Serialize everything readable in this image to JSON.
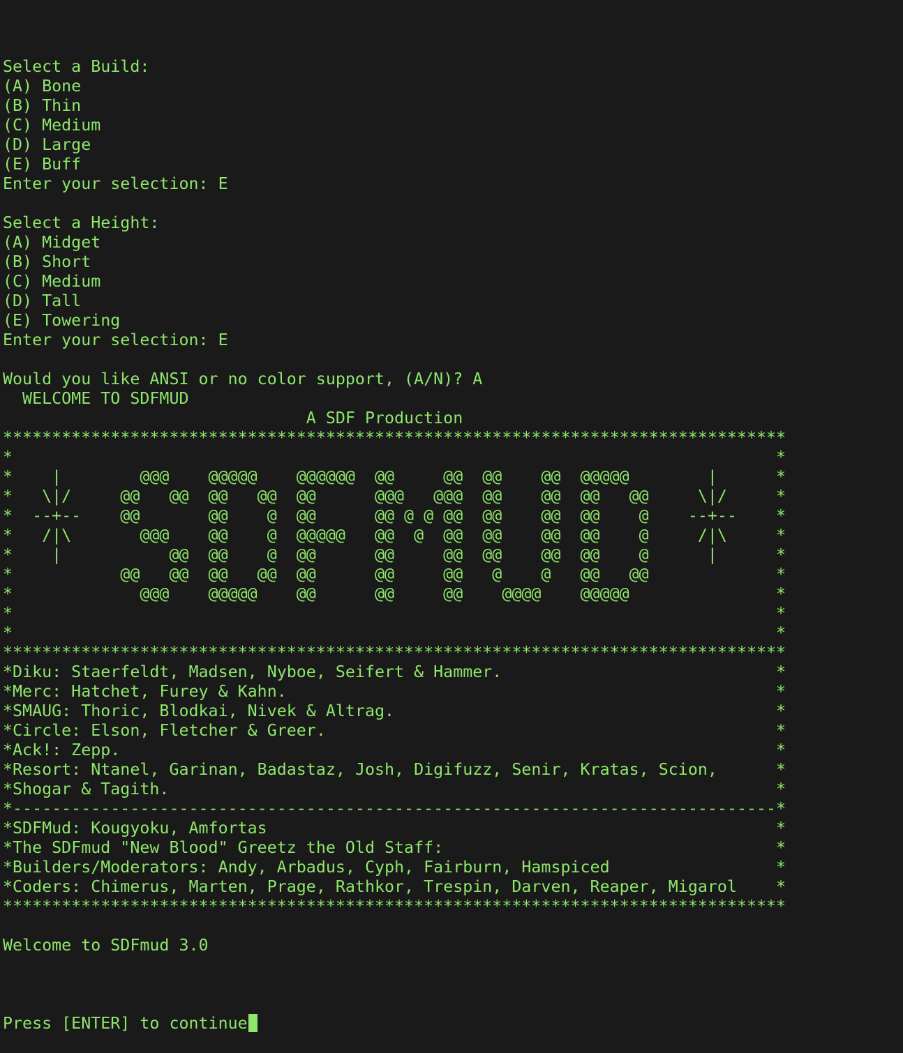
{
  "colors": {
    "background": "#1a1a1a",
    "foreground": "#8ee66b"
  },
  "terminal": {
    "lines": [
      "Select a Build:",
      "(A) Bone",
      "(B) Thin",
      "(C) Medium",
      "(D) Large",
      "(E) Buff",
      "Enter your selection: E",
      "",
      "Select a Height:",
      "(A) Midget",
      "(B) Short",
      "(C) Medium",
      "(D) Tall",
      "(E) Towering",
      "Enter your selection: E",
      "",
      "Would you like ANSI or no color support, (A/N)? A",
      "  WELCOME TO SDFMUD",
      "                               A SDF Production",
      "********************************************************************************",
      "*                                                                              *",
      "*    |        @@@    @@@@@    @@@@@@  @@     @@  @@    @@  @@@@@        |      *",
      "*   \\|/     @@   @@  @@   @@  @@      @@@   @@@  @@    @@  @@   @@     \\|/     *",
      "*  --+--    @@       @@    @  @@      @@ @ @ @@  @@    @@  @@    @    --+--    *",
      "*   /|\\       @@@    @@    @  @@@@@   @@  @  @@  @@    @@  @@    @     /|\\     *",
      "*    |           @@  @@    @  @@      @@     @@  @@    @@  @@    @      |      *",
      "*           @@   @@  @@   @@  @@      @@     @@   @    @   @@   @@             *",
      "*             @@@    @@@@@    @@      @@     @@    @@@@    @@@@@               *",
      "*                                                                              *",
      "*                                                                              *",
      "********************************************************************************",
      "*Diku: Staerfeldt, Madsen, Nyboe, Seifert & Hammer.                            *",
      "*Merc: Hatchet, Furey & Kahn.                                                  *",
      "*SMAUG: Thoric, Blodkai, Nivek & Altrag.                                       *",
      "*Circle: Elson, Fletcher & Greer.                                              *",
      "*Ack!: Zepp.                                                                   *",
      "*Resort: Ntanel, Garinan, Badastaz, Josh, Digifuzz, Senir, Kratas, Scion,      *",
      "*Shogar & Tagith.                                                              *",
      "*------------------------------------------------------------------------------*",
      "*SDFMud: Kougyoku, Amfortas                                                    *",
      "*The SDFmud \"New Blood\" Greetz the Old Staff:                                  *",
      "*Builders/Moderators: Andy, Arbadus, Cyph, Fairburn, Hamspiced                 *",
      "*Coders: Chimerus, Marten, Prage, Rathkor, Trespin, Darven, Reaper, Migarol    *",
      "********************************************************************************",
      "",
      "Welcome to SDFmud 3.0",
      ""
    ],
    "prompt": "Press [ENTER] to continue"
  }
}
